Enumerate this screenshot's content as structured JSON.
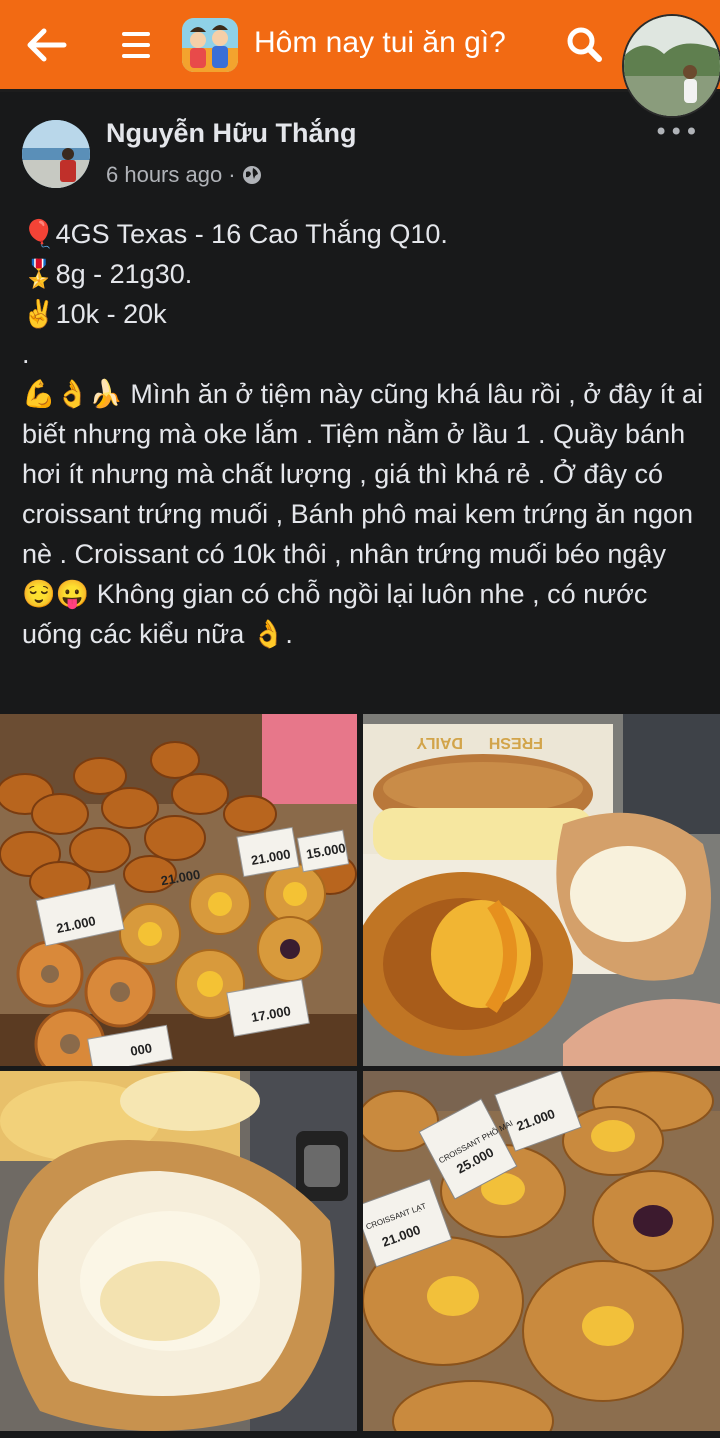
{
  "app": {
    "title": "Hôm nay tui ăn gì?"
  },
  "icons": {
    "back": "arrow-left-icon",
    "menu": "hamburger-menu-icon",
    "search": "search-icon",
    "privacy": "globe-icon",
    "more": "more-options-icon"
  },
  "colors": {
    "brand": "#f26a13",
    "background": "#18191a",
    "text": "#e4e6eb",
    "muted": "#b0b3b8"
  },
  "post": {
    "author": "Nguyễn Hữu Thắng",
    "time": "6 hours ago",
    "separator": "·",
    "more": "•••",
    "lines": [
      "🎈4GS Texas - 16 Cao Thắng Q10.",
      "🎖️8g - 21g30.",
      "✌️10k - 20k",
      "."
    ],
    "body": "💪👌🍌 Mình ăn ở tiệm này cũng khá lâu rồi , ở đây ít ai biết nhưng mà oke lắm . Tiệm nằm ở lầu 1 . Quầy bánh hơi ít nhưng mà chất lượng , giá thì khá rẻ . Ở đây có croissant trứng muối , Bánh phô mai kem trứng ăn ngon nè . Croissant có 10k thôi , nhân trứng muối béo ngậy 😌😛 Không gian có chỗ ngồi lại luôn nhe , có nước uống các kiểu nữa 👌."
  },
  "photos": {
    "p1_labels": [
      "21.000",
      "21.000",
      "17.000",
      "21.000",
      "15.000",
      "000"
    ],
    "p2_labels": [
      "FRESH",
      "DAILY"
    ],
    "p4_labels": [
      "21.000",
      "25.000",
      "21.000",
      "CROISSANT PHÔ MAI",
      "CROISSANT LẠT"
    ]
  }
}
